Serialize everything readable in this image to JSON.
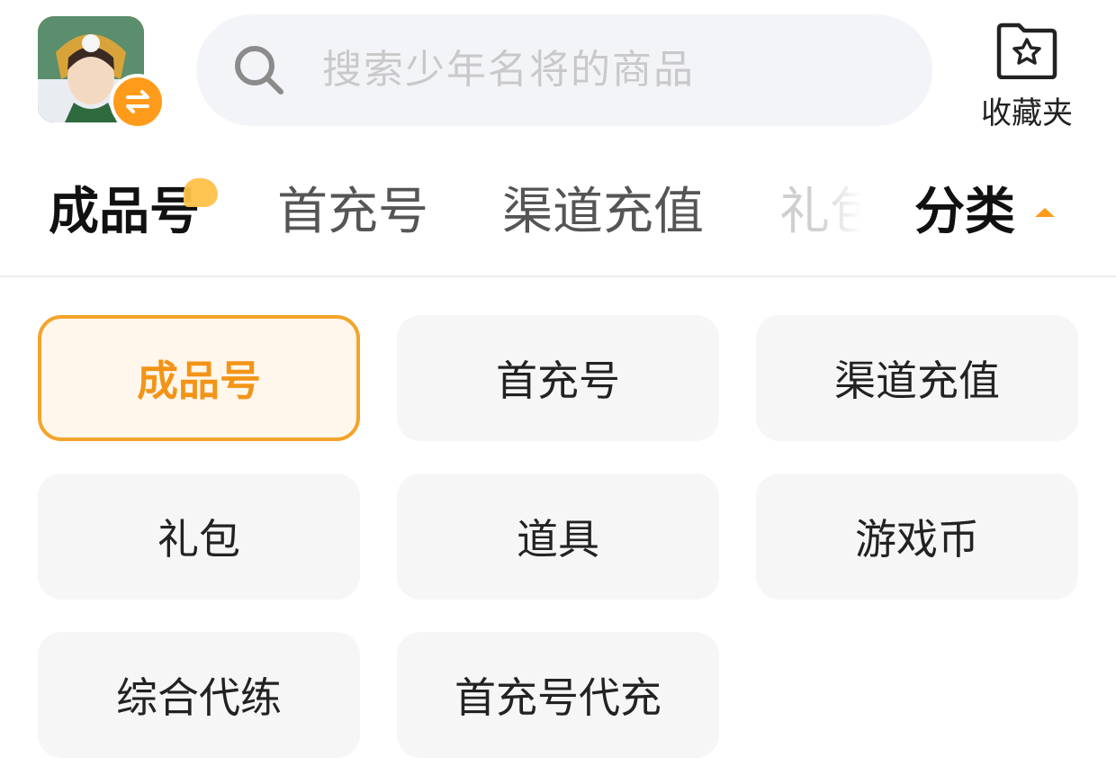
{
  "header": {
    "game_icon_label": "少年名将",
    "search": {
      "placeholder": "搜索少年名将的商品"
    },
    "favorites_label": "收藏夹"
  },
  "tabs": [
    {
      "label": "成品号",
      "active": true,
      "hot": true
    },
    {
      "label": "首充号",
      "active": false
    },
    {
      "label": "渠道充值",
      "active": false
    },
    {
      "label": "礼包",
      "active": false,
      "truncated": true
    }
  ],
  "category_toggle": {
    "label": "分类",
    "state": "expanded"
  },
  "categories": [
    {
      "label": "成品号",
      "selected": true
    },
    {
      "label": "首充号",
      "selected": false
    },
    {
      "label": "渠道充值",
      "selected": false
    },
    {
      "label": "礼包",
      "selected": false
    },
    {
      "label": "道具",
      "selected": false
    },
    {
      "label": "游戏币",
      "selected": false
    },
    {
      "label": "综合代练",
      "selected": false
    },
    {
      "label": "首充号代充",
      "selected": false
    }
  ],
  "colors": {
    "accent": "#f39418",
    "selected_bg": "#fff7ec",
    "cell_bg": "#f6f6f6",
    "search_bg": "#f3f4f8"
  }
}
